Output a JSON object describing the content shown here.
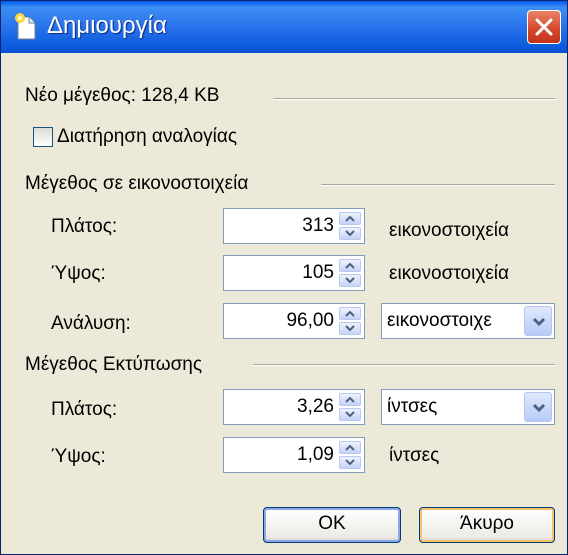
{
  "window": {
    "title": "Δημιουργία"
  },
  "new_size_label": "Νέο μέγεθος: 128,4 KB",
  "keep_ratio_label": "Διατήρηση αναλογίας",
  "keep_ratio_checked": false,
  "pixel_size": {
    "heading": "Μέγεθος σε εικονοστοιχεία",
    "width_label": "Πλάτος:",
    "width_value": "313",
    "width_unit": "εικονοστοιχεία",
    "height_label": "Ύψος:",
    "height_value": "105",
    "height_unit": "εικονοστοιχεία",
    "resolution_label": "Ανάλυση:",
    "resolution_value": "96,00",
    "resolution_unit": "εικονοστοιχε"
  },
  "print_size": {
    "heading": "Μέγεθος Εκτύπωσης",
    "width_label": "Πλάτος:",
    "width_value": "3,26",
    "width_unit": "ίντσες",
    "height_label": "Ύψος:",
    "height_value": "1,09",
    "height_unit": "ίντσες"
  },
  "buttons": {
    "ok": "OK",
    "cancel": "Άκυρο"
  },
  "colors": {
    "titlebar": "#0b5fe0",
    "dialog_bg": "#ece9d8",
    "close": "#d5462a"
  }
}
